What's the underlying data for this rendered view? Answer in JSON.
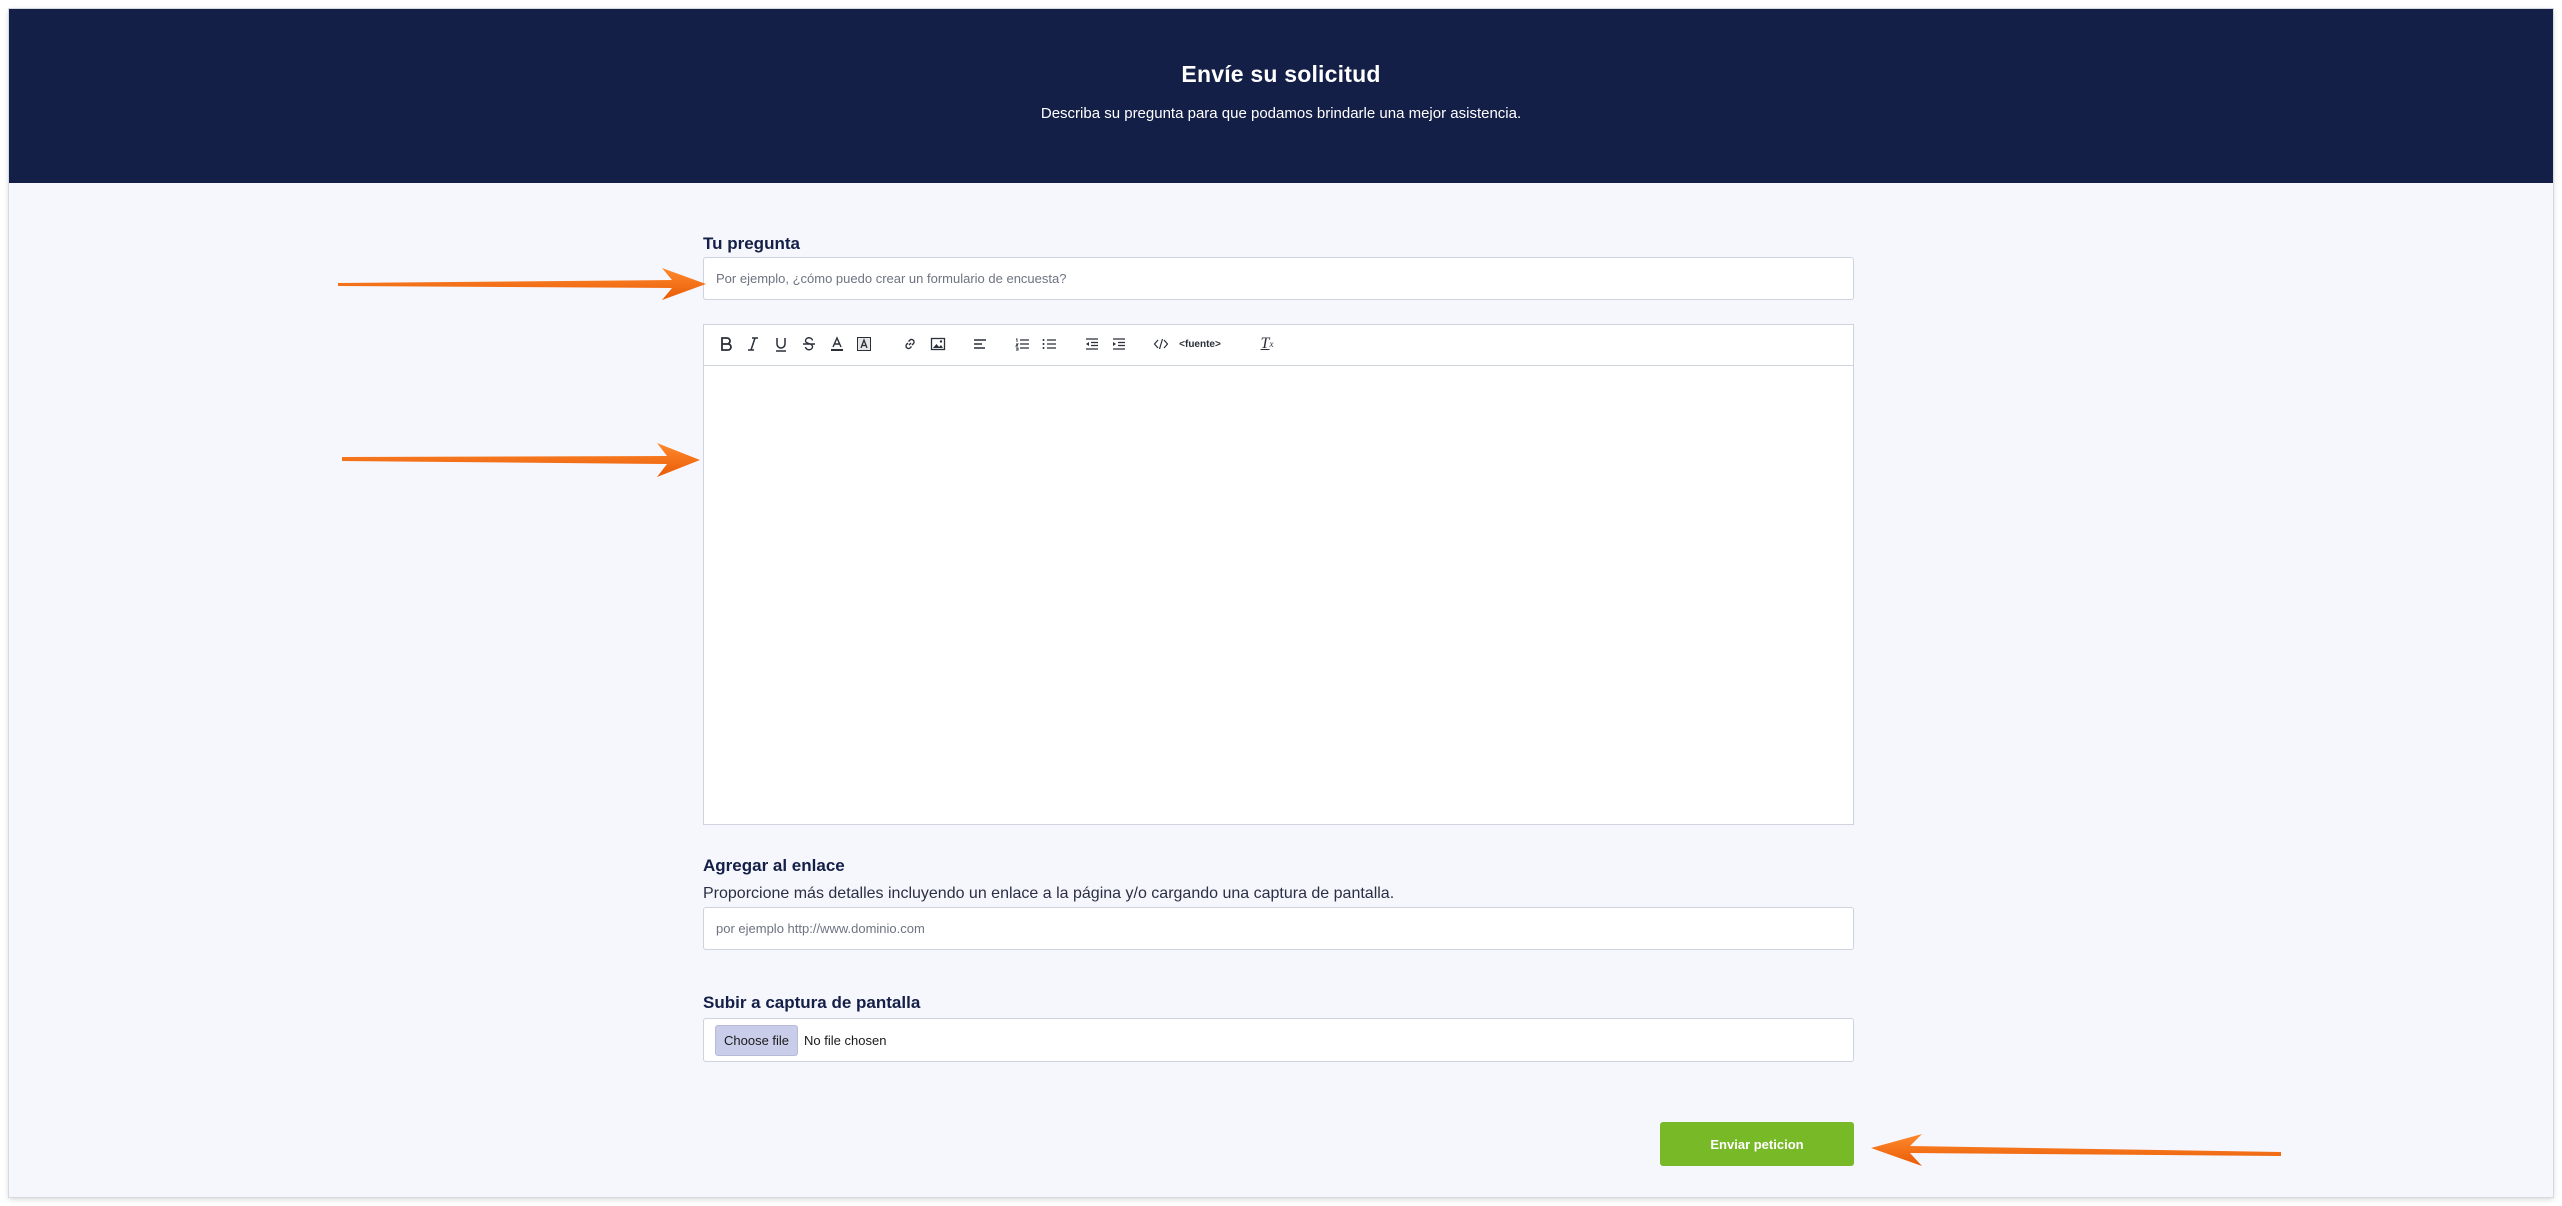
{
  "header": {
    "title": "Envíe su solicitud",
    "subtitle": "Describa su pregunta para que podamos brindarle una mejor asistencia."
  },
  "question": {
    "label": "Tu pregunta",
    "placeholder": "Por ejemplo, ¿cómo puedo crear un formulario de encuesta?"
  },
  "editor": {
    "toolbar": [
      {
        "name": "bold",
        "icon": "bold-icon"
      },
      {
        "name": "italic",
        "icon": "italic-icon"
      },
      {
        "name": "underline",
        "icon": "underline-icon"
      },
      {
        "name": "strikethrough",
        "icon": "strikethrough-icon"
      },
      {
        "name": "text-color",
        "icon": "text-color-icon"
      },
      {
        "name": "background-color",
        "icon": "highlight-icon"
      },
      {
        "name": "link",
        "icon": "link-icon"
      },
      {
        "name": "image",
        "icon": "image-icon"
      },
      {
        "name": "align",
        "icon": "align-left-icon"
      },
      {
        "name": "ordered-list",
        "icon": "ordered-list-icon"
      },
      {
        "name": "bullet-list",
        "icon": "bullet-list-icon"
      },
      {
        "name": "outdent",
        "icon": "outdent-icon"
      },
      {
        "name": "indent",
        "icon": "indent-icon"
      },
      {
        "name": "code",
        "icon": "code-icon"
      },
      {
        "name": "source",
        "icon": "source-icon"
      },
      {
        "name": "clear-format",
        "icon": "clear-format-icon"
      }
    ],
    "source_label": "<fuente>",
    "clear_label": "T",
    "clear_sub": "x"
  },
  "link": {
    "label": "Agregar al enlace",
    "description": "Proporcione más detalles incluyendo un enlace a la página y/o cargando una captura de pantalla.",
    "placeholder": "por ejemplo http://www.dominio.com"
  },
  "screenshot": {
    "label": "Subir a captura de pantalla",
    "button_label": "Choose file",
    "status": "No file chosen"
  },
  "submit": {
    "label": "Enviar peticion"
  },
  "colors": {
    "header_bg": "#141f47",
    "page_bg": "#f6f7fc",
    "submit_bg": "#78b928",
    "arrow": "#f26a10"
  }
}
